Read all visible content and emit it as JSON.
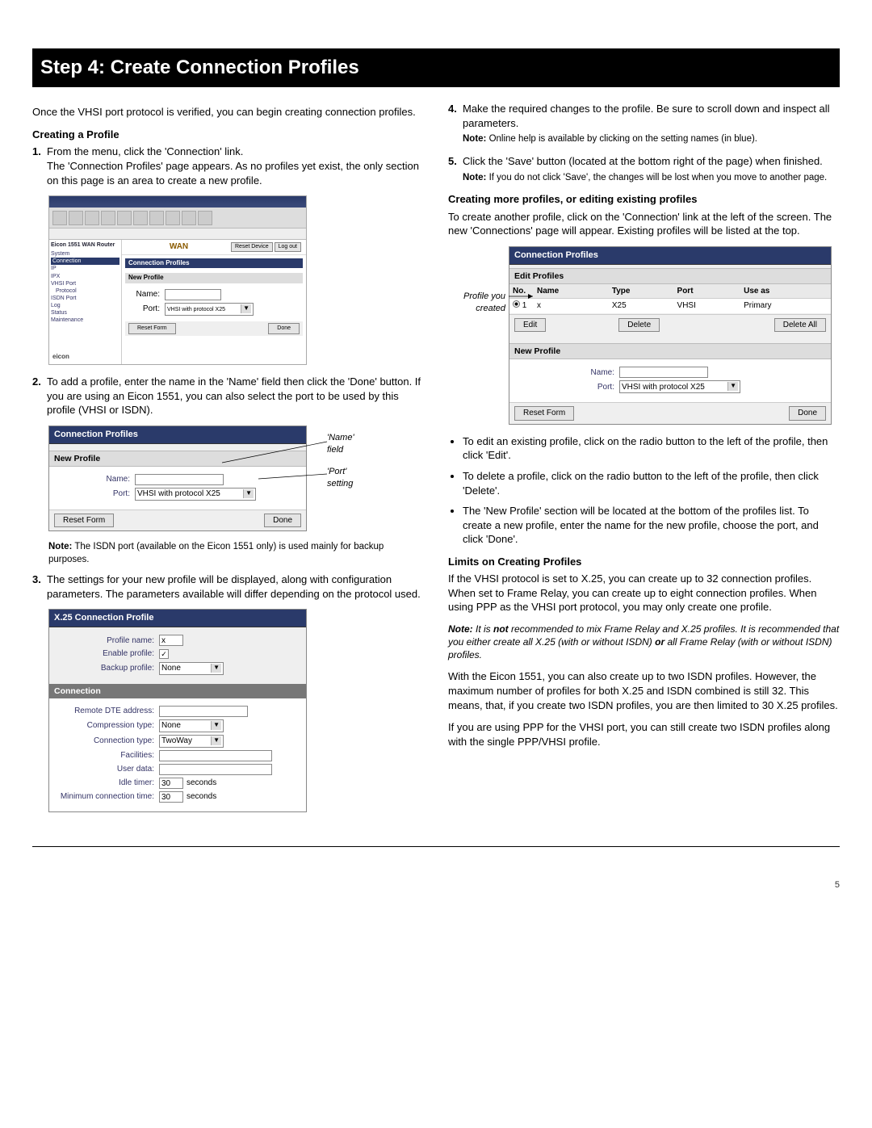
{
  "title": "Step 4: Create Connection Profiles",
  "intro": "Once the VHSI port protocol is verified, you can begin creating connection profiles.",
  "left": {
    "h1": "Creating a Profile",
    "li1_num": "1.",
    "li1a": "From the menu, click the 'Connection' link.",
    "li1b": "The 'Connection Profiles' page appears. As no profiles yet exist, the only section on this page is an area to create a new profile.",
    "li2_num": "2.",
    "li2": "To add a profile, enter the name in the 'Name' field then click the 'Done' button. If you are using an Eicon 1551, you can also select the port to be used by this profile (VHSI or ISDN).",
    "note1_label": "Note:",
    "note1": " The ISDN port (available on the Eicon 1551 only) is used mainly for backup purposes.",
    "li3_num": "3.",
    "li3": "The settings for your new profile will be displayed, along with configuration parameters. The parameters available will differ depending on the protocol used.",
    "callout_name": "'Name' field",
    "callout_port": "'Port' setting"
  },
  "right": {
    "li4_num": "4.",
    "li4": "Make the required changes to the profile. Be sure to scroll down and inspect all parameters.",
    "note4_label": "Note:",
    "note4": " Online help is available by clicking on the setting names (in blue).",
    "li5_num": "5.",
    "li5": "Click the 'Save' button (located at the bottom right of the page) when finished.",
    "note5_label": "Note:",
    "note5": " If you do not click 'Save', the changes will be lost when you move to another page.",
    "h2": "Creating more profiles, or editing existing profiles",
    "p2": "To create another profile, click on the 'Connection' link at the left of the screen. The new 'Connections' page will appear. Existing profiles will be listed at the top.",
    "callout_profile": "Profile you created",
    "bul1": "To edit an existing profile, click on the radio button to the left of the profile, then click 'Edit'.",
    "bul2": "To delete a profile, click on the radio button to the left of the profile, then click 'Delete'.",
    "bul3": "The 'New Profile' section will be located at the bottom of the profiles list. To create a new profile, enter the name for the new profile, choose the port, and click 'Done'.",
    "h3": "Limits on Creating Profiles",
    "p3": "If the VHSI protocol is set to X.25, you can create up to 32 connection profiles. When set to Frame Relay, you can create up to eight connection profiles. When using PPP as the VHSI port protocol, you may only create one profile.",
    "note_ital_label": "Note:",
    "note_ital_a": " It is ",
    "note_ital_not": "not",
    "note_ital_b": " recommended to mix Frame Relay and X.25 profiles. It is recommended that you either create all X.25 (with or without ISDN) ",
    "note_ital_or": "or",
    "note_ital_c": " all Frame Relay (with or without ISDN) profiles.",
    "p4": "With the Eicon 1551, you can also create up to two ISDN profiles. However, the maximum number of profiles for both X.25 and ISDN combined is still 32. This means, that, if you create two ISDN profiles, you are then limited to 30 X.25 profiles.",
    "p5": "If you are using PPP for the VHSI port, you can still create two ISDN profiles along with the single PPP/VHSI profile."
  },
  "fig1": {
    "title": "Connection Profiles",
    "new_profile": "New Profile",
    "name_label": "Name:",
    "port_label": "Port:",
    "port_value": "VHSI with protocol X25",
    "reset": "Reset Form",
    "done": "Done"
  },
  "fig2": {
    "title": "X.25 Connection Profile",
    "profile_name_label": "Profile name:",
    "profile_name_value": "x",
    "enable_label": "Enable profile:",
    "backup_label": "Backup profile:",
    "backup_value": "None",
    "connection": "Connection",
    "remote_dte": "Remote DTE address:",
    "compression": "Compression type:",
    "compression_value": "None",
    "conn_type": "Connection type:",
    "conn_type_value": "TwoWay",
    "facilities": "Facilities:",
    "user_data": "User data:",
    "idle_timer": "Idle timer:",
    "idle_timer_value": "30",
    "seconds": "seconds",
    "min_conn": "Minimum connection time:",
    "min_conn_value": "30"
  },
  "fig3": {
    "title": "Connection Profiles",
    "edit_profiles": "Edit Profiles",
    "th_no": "No.",
    "th_name": "Name",
    "th_type": "Type",
    "th_port": "Port",
    "th_use": "Use as",
    "row_no": "1",
    "row_name": "x",
    "row_type": "X25",
    "row_port": "VHSI",
    "row_use": "Primary",
    "edit": "Edit",
    "delete": "Delete",
    "delete_all": "Delete All",
    "new_profile": "New Profile",
    "name_label": "Name:",
    "port_label": "Port:",
    "port_value": "VHSI with protocol X25",
    "reset": "Reset Form",
    "done": "Done"
  },
  "mini": {
    "router": "Eicon 1551 WAN Router",
    "wan": "WAN",
    "side": [
      "System",
      "Connection",
      "IP",
      "IPX",
      "VHSI Port",
      "Protocol",
      "ISDN Port",
      "Log",
      "Status",
      "Maintenance"
    ],
    "cp": "Connection Profiles",
    "np": "New Profile",
    "name_label": "Name:",
    "port_label": "Port:",
    "port_value": "VHSI with protocol X25",
    "reset": "Reset Form",
    "done": "Done",
    "logo": "eicon"
  },
  "page": "5"
}
